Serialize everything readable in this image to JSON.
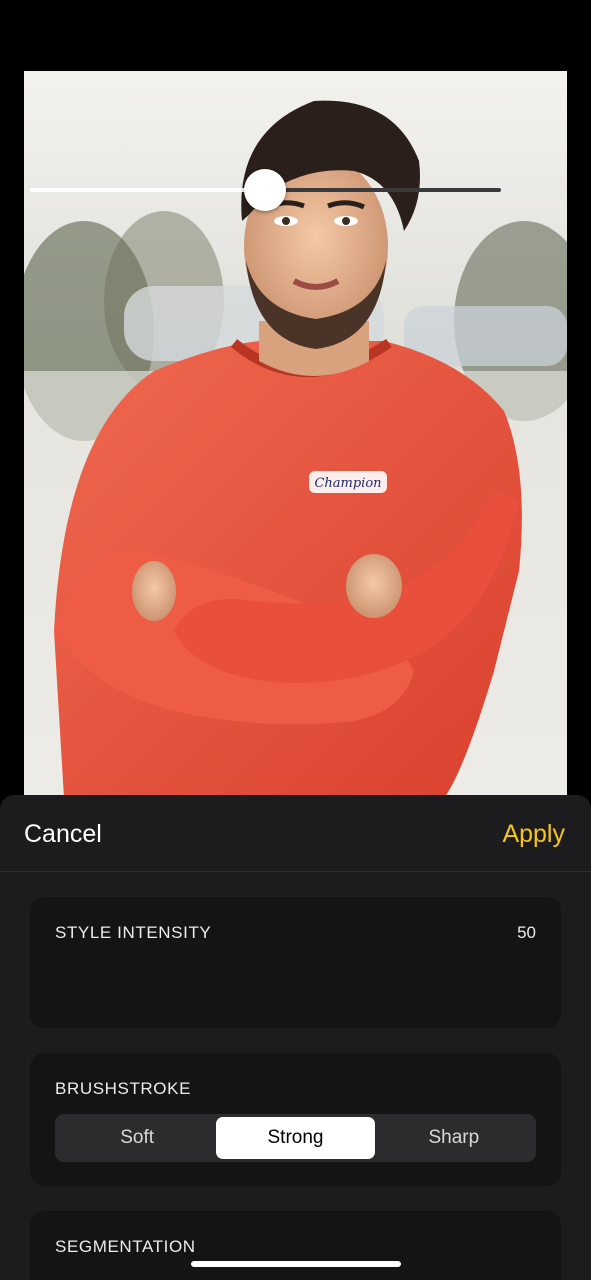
{
  "photo": {
    "description_icon": "portrait-photo-image",
    "sweater_logo_text": "Champion"
  },
  "header": {
    "cancel_label": "Cancel",
    "apply_label": "Apply"
  },
  "style_intensity": {
    "label": "STYLE INTENSITY",
    "value": "50",
    "fraction": 0.5
  },
  "brushstroke": {
    "label": "BRUSHSTROKE",
    "options": [
      "Soft",
      "Strong",
      "Sharp"
    ],
    "selected": "Strong"
  },
  "segmentation": {
    "label": "SEGMENTATION"
  },
  "colors": {
    "accent": "#f5c518",
    "sheet_background": "#1c1c1e",
    "card_background": "#141415"
  }
}
